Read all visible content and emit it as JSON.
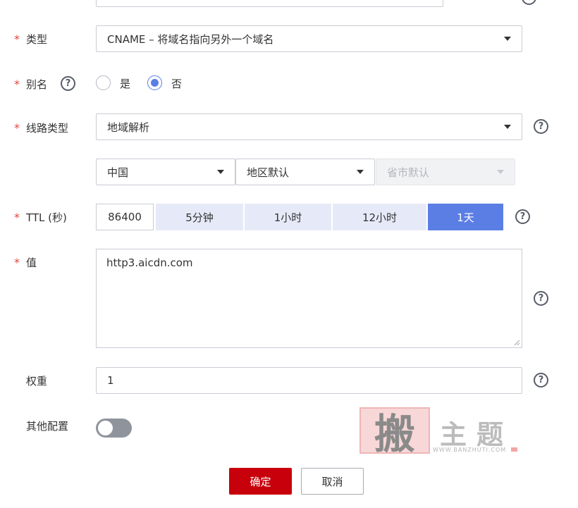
{
  "form": {
    "type": {
      "label": "类型",
      "value": "CNAME – 将域名指向另外一个域名"
    },
    "alias": {
      "label": "别名",
      "options": [
        "是",
        "否"
      ],
      "selected": "否"
    },
    "line_type": {
      "label": "线路类型",
      "value": "地域解析",
      "sub": {
        "country": "中国",
        "region": "地区默认",
        "province": "省市默认"
      }
    },
    "ttl": {
      "label": "TTL (秒)",
      "value": "86400",
      "presets": [
        "5分钟",
        "1小时",
        "12小时",
        "1天"
      ],
      "active_preset": "1天"
    },
    "value": {
      "label": "值",
      "text": "http3.aicdn.com"
    },
    "weight": {
      "label": "权重",
      "value": "1"
    },
    "other_config": {
      "label": "其他配置",
      "enabled": false
    }
  },
  "actions": {
    "confirm": "确定",
    "cancel": "取消"
  },
  "icons": {
    "required": "*",
    "help": "?"
  },
  "watermark": {
    "mark": "搬",
    "title": "主题",
    "url": "WWW.BANZHUTI.COM"
  },
  "colors": {
    "accent": "#5b7ee5",
    "primary_button": "#c7000b",
    "required_star": "#e0473e",
    "preset_bg": "#e6eaf8"
  }
}
